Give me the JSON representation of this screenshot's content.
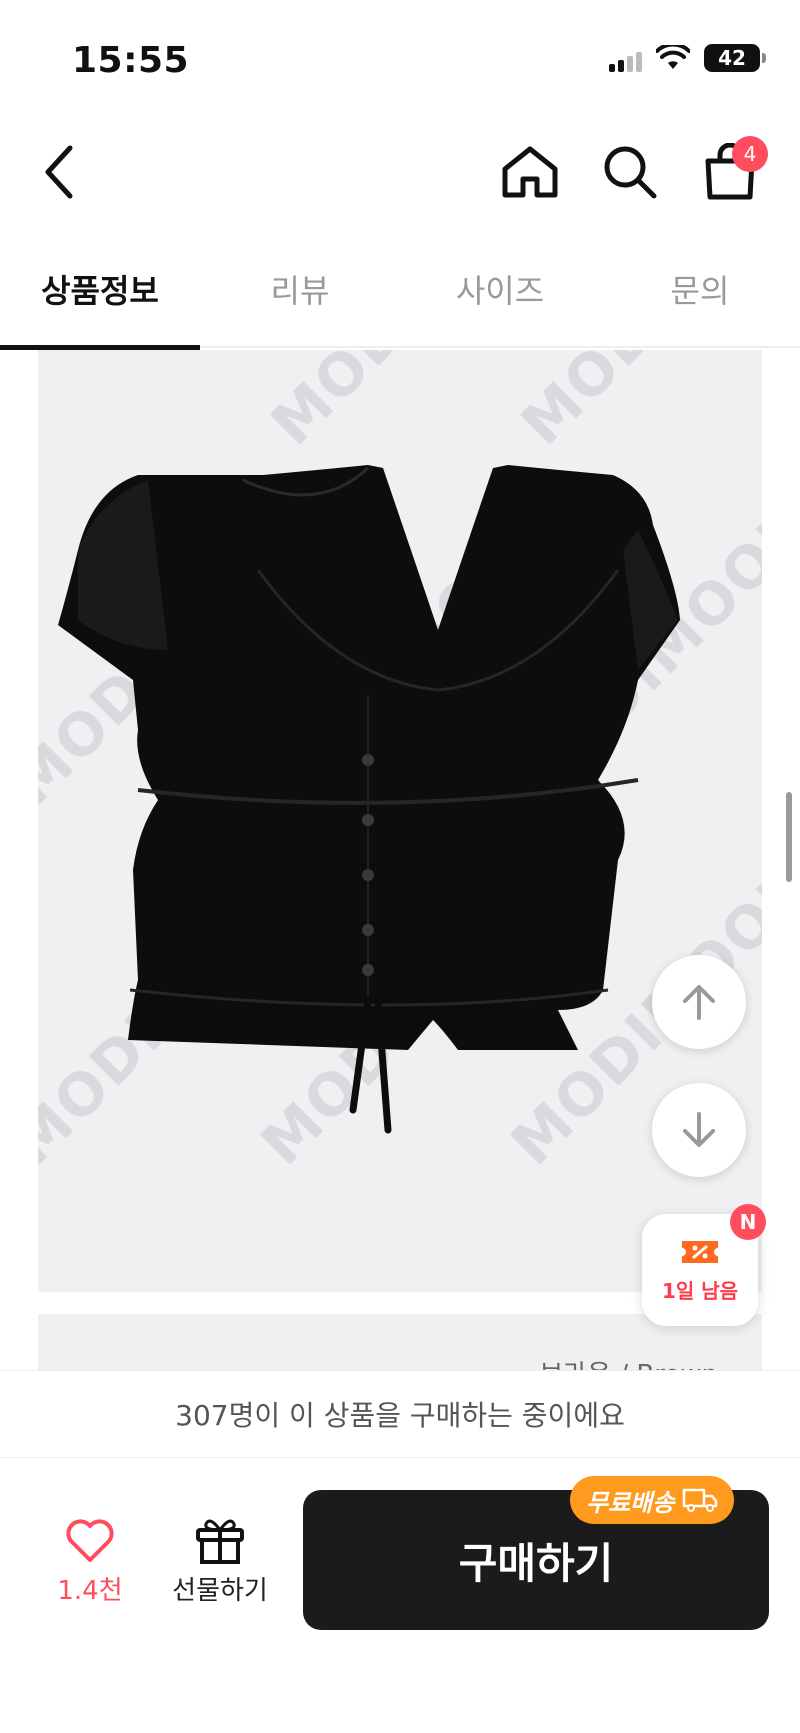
{
  "status_bar": {
    "time": "15:55",
    "battery": "42",
    "icons": [
      "signal-icon",
      "wifi-icon",
      "battery-icon"
    ]
  },
  "header": {
    "back_icon": "chevron-left-icon",
    "home_icon": "home-icon",
    "search_icon": "search-icon",
    "cart_icon": "shopping-bag-icon",
    "cart_count": "4"
  },
  "tabs": [
    {
      "label": "상품정보",
      "active": true
    },
    {
      "label": "리뷰",
      "active": false
    },
    {
      "label": "사이즈",
      "active": false
    },
    {
      "label": "문의",
      "active": false
    }
  ],
  "content": {
    "product_image_desc_icon": "product-photo",
    "watermark": "MODIMOOD",
    "next_color_label": "브라운 / Brown"
  },
  "floating": {
    "scroll_up_icon": "arrow-up-icon",
    "scroll_down_icon": "arrow-down-icon",
    "coupon_icon": "coupon-icon",
    "coupon_text": "1일 남음",
    "coupon_badge": "N"
  },
  "purchase_banner": "307명이 이 상품을 구매하는 중이에요",
  "bottom_bar": {
    "like_icon": "heart-icon",
    "like_count": "1.4천",
    "gift_icon": "gift-icon",
    "gift_label": "선물하기",
    "buy_label": "구매하기",
    "free_shipping_label": "무료배송",
    "truck_icon": "truck-icon"
  },
  "colors": {
    "accent_red": "#ff4d5e",
    "buy_button": "#1b1b1b",
    "free_shipping": "#ff9a1f"
  }
}
